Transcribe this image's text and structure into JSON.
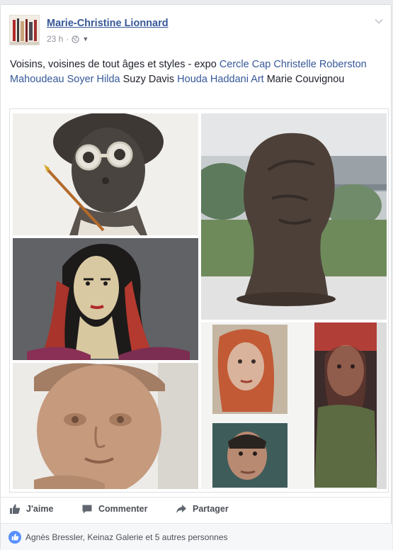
{
  "post": {
    "author": "Marie-Christine Lionnard",
    "time": "23 h",
    "time_separator": "·",
    "privacy_icon": "globe-icon",
    "text_segments": [
      {
        "text": "Voisins, voisines de tout âges et styles - expo ",
        "tag": false
      },
      {
        "text": "Cercle Cap Christelle Roberston Mahoudeau Soyer Hilda",
        "tag": true
      },
      {
        "text": " Suzy Davis ",
        "tag": false
      },
      {
        "text": "Houda Haddani Art",
        "tag": true
      },
      {
        "text": " Marie Couvignou",
        "tag": false
      }
    ]
  },
  "photos": [
    {
      "name": "sculpture-girl-with-glasses"
    },
    {
      "name": "clay-bust-head"
    },
    {
      "name": "painting-woman-red-hair"
    },
    {
      "name": "sculpture-child-face"
    },
    {
      "name": "portraits-wall"
    }
  ],
  "actions": {
    "like_label": "J'aime",
    "comment_label": "Commenter",
    "share_label": "Partager"
  },
  "reactions": {
    "text": "Agnès Bressler, Keinaz Galerie et 5 autres personnes"
  },
  "colors": {
    "link": "#365899",
    "like_badge": "#5890ff"
  }
}
